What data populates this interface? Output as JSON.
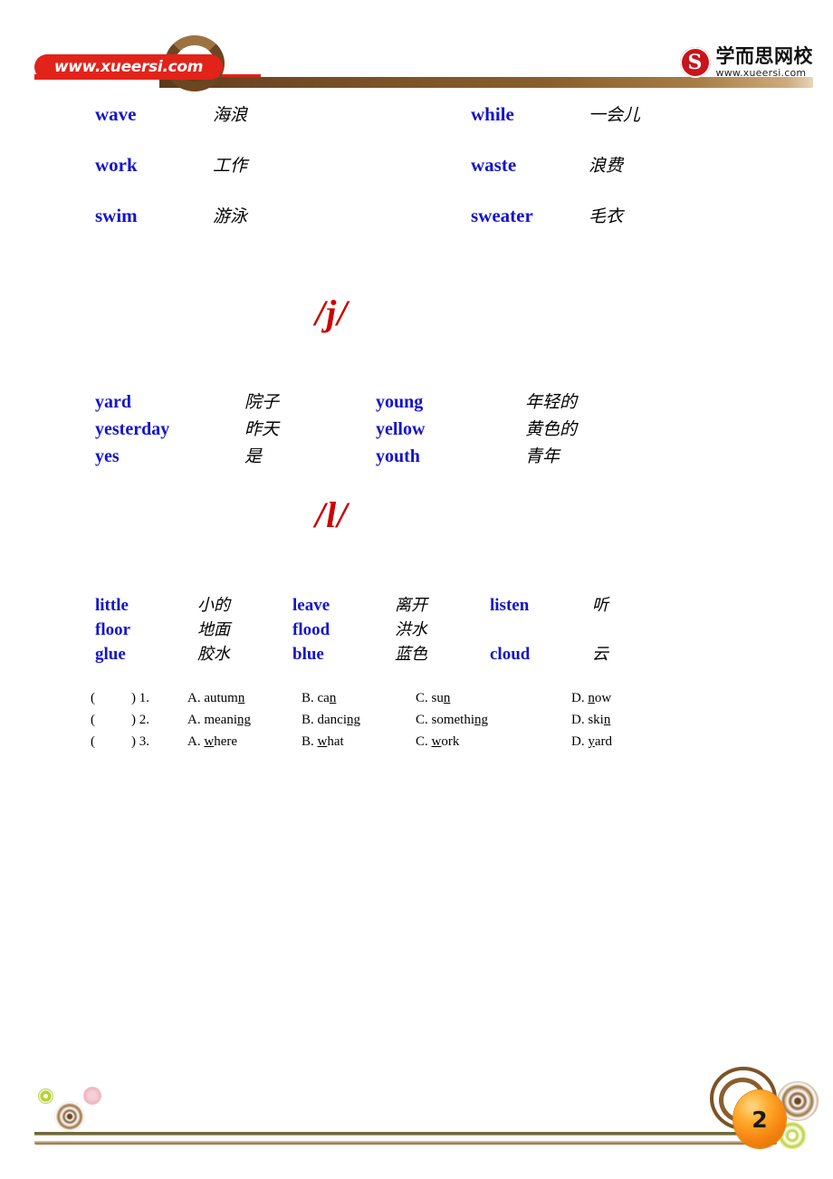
{
  "header": {
    "url_pill": "www.xueersi.com",
    "brand_mark": "S",
    "brand_cn": "学而思网校",
    "brand_en": "www.xueersi.com"
  },
  "sections": [
    {
      "id": "section-w",
      "rows": [
        {
          "left_en": "wave",
          "left_cn": "海浪",
          "right_en": "while",
          "right_cn": "一会儿"
        },
        {
          "left_en": "work",
          "left_cn": "工作",
          "right_en": "waste",
          "right_cn": "浪费"
        },
        {
          "left_en": "swim",
          "left_cn": "游泳",
          "right_en": "sweater",
          "right_cn": "毛衣"
        }
      ]
    },
    {
      "id": "section-j",
      "heading": "/j/",
      "rows": [
        {
          "left_en": "yard",
          "left_cn": "院子",
          "right_en": "young",
          "right_cn": "年轻的"
        },
        {
          "left_en": "yesterday",
          "left_cn": "昨天",
          "right_en": "yellow",
          "right_cn": "黄色的"
        },
        {
          "left_en": "yes",
          "left_cn": "是",
          "right_en": "youth",
          "right_cn": "青年"
        }
      ]
    },
    {
      "id": "section-l",
      "heading": "/l/",
      "rows": [
        {
          "c1_en": "little",
          "c1_cn": "小的",
          "c2_en": "leave",
          "c2_cn": "离开",
          "c3_en": "listen",
          "c3_cn": "听"
        },
        {
          "c1_en": "floor",
          "c1_cn": "地面",
          "c2_en": "flood",
          "c2_cn": "洪水",
          "c3_en": "",
          "c3_cn": ""
        },
        {
          "c1_en": "glue",
          "c1_cn": "胶水",
          "c2_en": "blue",
          "c2_cn": "蓝色",
          "c3_en": "cloud",
          "c3_cn": "云"
        }
      ]
    }
  ],
  "quiz": {
    "paren_open": "(",
    "paren_close": ")",
    "questions": [
      {
        "number": "1.",
        "a_pre": "A. autum",
        "a_u": "n",
        "a_post": "",
        "b_pre": "B. ca",
        "b_u": "n",
        "b_post": "",
        "c_pre": "C. su",
        "c_u": "n",
        "c_post": "",
        "d_pre": "D. ",
        "d_u": "n",
        "d_post": "ow"
      },
      {
        "number": "2.",
        "a_pre": "A. meani",
        "a_u": "ng",
        "a_post": "",
        "b_pre": "B. danci",
        "b_u": "ng",
        "b_post": "",
        "c_pre": "C. somethi",
        "c_u": "ng",
        "c_post": "",
        "d_pre": "D. ski",
        "d_u": "n",
        "d_post": ""
      },
      {
        "number": "3.",
        "a_pre": "A. ",
        "a_u": "w",
        "a_post": "here",
        "b_pre": "B. ",
        "b_u": "w",
        "b_post": "hat",
        "c_pre": "C. ",
        "c_u": "w",
        "c_post": "ork",
        "d_pre": "D. ",
        "d_u": "y",
        "d_post": "ard"
      }
    ]
  },
  "footer": {
    "page_number": "2"
  }
}
